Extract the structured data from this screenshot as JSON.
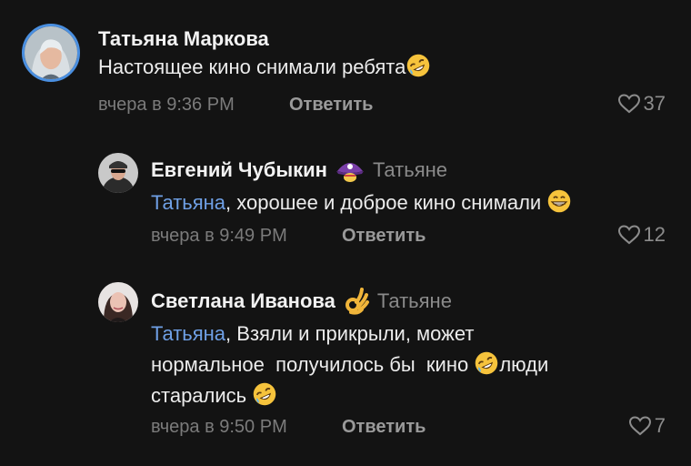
{
  "comments": [
    {
      "author": "Татьяна Маркова",
      "text": "Настоящее кино снимали ребята",
      "emoji_after_text": "rofl-emoji",
      "time": "вчера в 9:36 PM",
      "reply_label": "Ответить",
      "likes": "37"
    },
    {
      "author": "Евгений Чубыкин",
      "author_badge": "pirate-badge-icon",
      "reply_to": "Татьяне",
      "mention": "Татьяна",
      "text": ", хорошее и доброе кино снимали",
      "emoji_after_text": "grin-emoji",
      "time": "вчера в 9:49 PM",
      "reply_label": "Ответить",
      "likes": "12"
    },
    {
      "author": "Светлана Иванова",
      "author_badge": "ok-hand-icon",
      "reply_to": "Татьяне",
      "mention": "Татьяна",
      "text_line1": ", Взяли и прикрыли, может",
      "text_line2a": "нормальное  получилось бы  кино ",
      "text_line2b": "люди",
      "text_line3": "старались ",
      "time": "вчера в 9:50 PM",
      "reply_label": "Ответить",
      "likes": "7"
    }
  ],
  "colors": {
    "background": "#131313",
    "mention": "#6fa0e6",
    "meta": "#7b7b7b",
    "avatar_ring": "#4a8fe0"
  }
}
